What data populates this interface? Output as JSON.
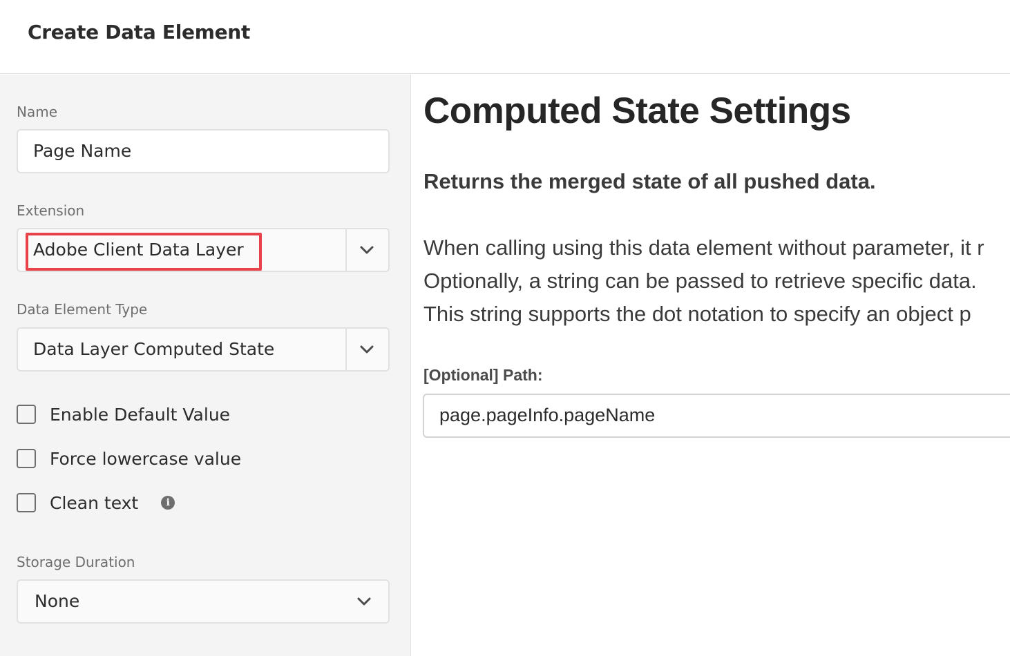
{
  "header": {
    "title": "Create Data Element"
  },
  "left_panel": {
    "name_label": "Name",
    "name_value": "Page Name",
    "extension_label": "Extension",
    "extension_value": "Adobe Client Data Layer",
    "type_label": "Data Element Type",
    "type_value": "Data Layer Computed State",
    "checkboxes": [
      {
        "label": "Enable Default Value",
        "checked": false
      },
      {
        "label": "Force lowercase value",
        "checked": false
      },
      {
        "label": "Clean text",
        "checked": false
      }
    ],
    "storage_label": "Storage Duration",
    "storage_value": "None",
    "icons": {
      "dropdown": "chevron-down-icon",
      "info": "info-icon"
    }
  },
  "right_panel": {
    "title": "Computed State Settings",
    "subtitle": "Returns the merged state of all pushed data.",
    "description_lines": [
      "When calling using this data element without parameter, it r",
      "Optionally, a string can be passed to retrieve specific data.",
      "This string supports the dot notation to specify an object p"
    ],
    "path_label": "[Optional] Path:",
    "path_value": "page.pageInfo.pageName"
  },
  "colors": {
    "highlight": "#e8424a",
    "panel_bg": "#f4f4f4"
  }
}
